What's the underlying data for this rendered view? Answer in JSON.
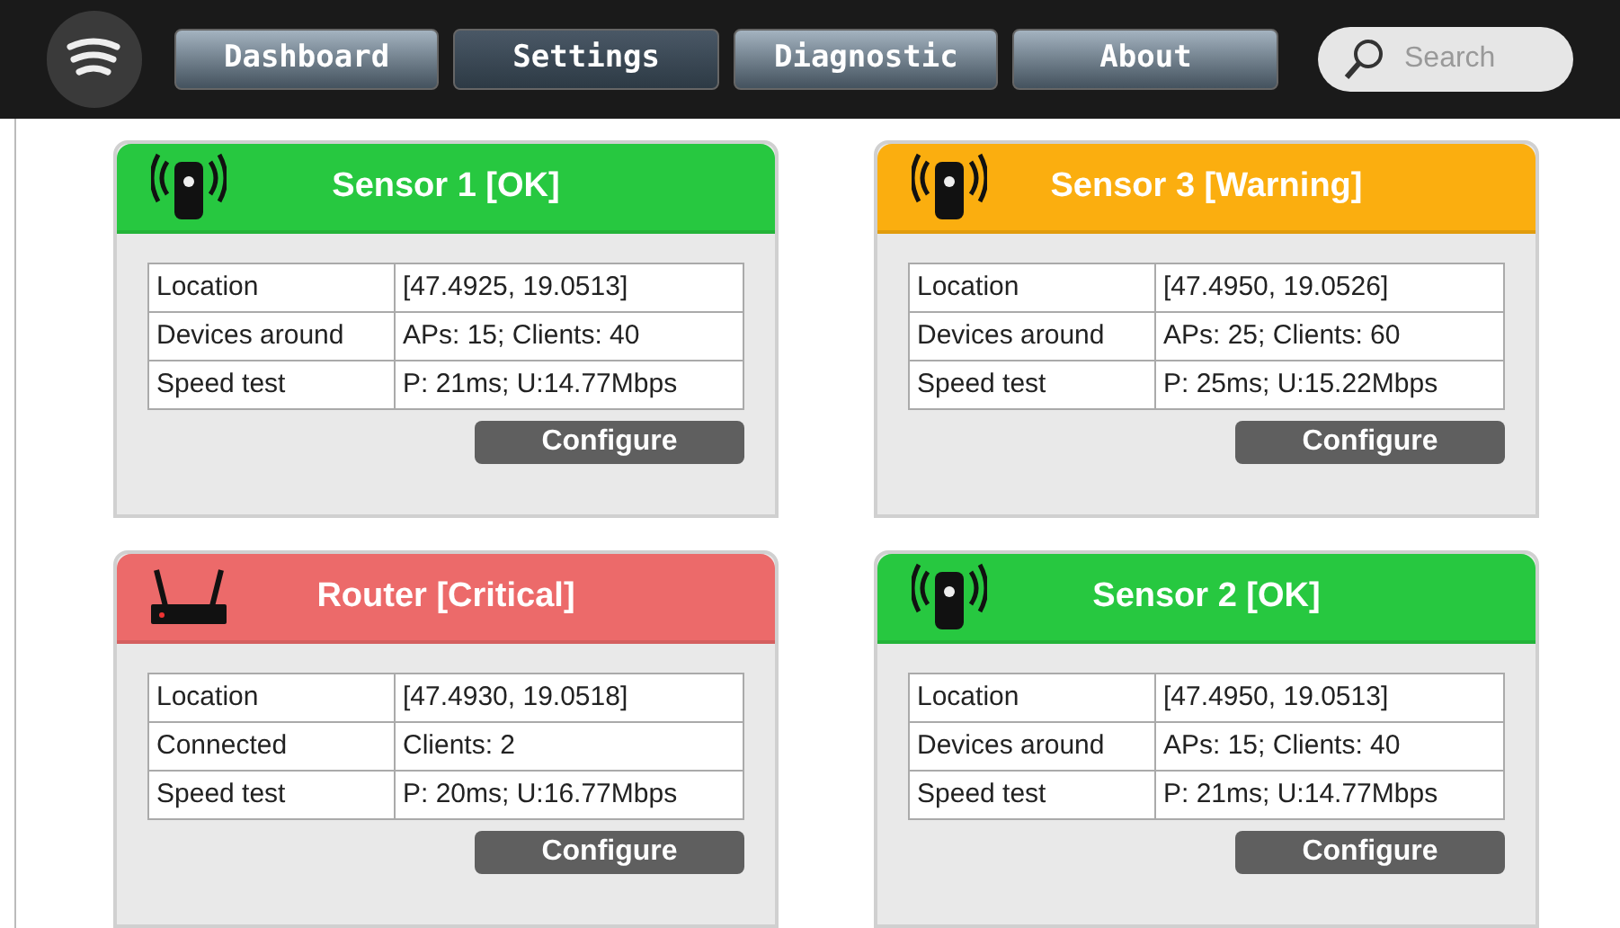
{
  "nav": {
    "tabs": [
      {
        "label": "Dashboard",
        "selected": false
      },
      {
        "label": "Settings",
        "selected": true
      },
      {
        "label": "Diagnostic",
        "selected": false
      },
      {
        "label": "About",
        "selected": false
      }
    ],
    "search": {
      "placeholder": "Search"
    }
  },
  "cards": [
    {
      "kind": "sensor",
      "color": "#27c840",
      "title": "Sensor 1 [OK]",
      "rows": [
        [
          "Location",
          "[47.4925, 19.0513]"
        ],
        [
          "Devices around",
          "APs: 15; Clients: 40"
        ],
        [
          "Speed test",
          "P: 21ms; U:14.77Mbps"
        ]
      ],
      "button": "Configure"
    },
    {
      "kind": "sensor",
      "color": "#fbae0f",
      "title": "Sensor 3 [Warning]",
      "rows": [
        [
          "Location",
          "[47.4950, 19.0526]"
        ],
        [
          "Devices around",
          "APs: 25; Clients: 60"
        ],
        [
          "Speed test",
          "P: 25ms; U:15.22Mbps"
        ]
      ],
      "button": "Configure"
    },
    {
      "kind": "router",
      "color": "#ec6a6a",
      "title": "Router [Critical]",
      "rows": [
        [
          "Location",
          "[47.4930, 19.0518]"
        ],
        [
          "Connected",
          "Clients: 2"
        ],
        [
          "Speed test",
          "P: 20ms; U:16.77Mbps"
        ]
      ],
      "button": "Configure"
    },
    {
      "kind": "sensor",
      "color": "#27c840",
      "title": "Sensor 2 [OK]",
      "rows": [
        [
          "Location",
          "[47.4950, 19.0513]"
        ],
        [
          "Devices around",
          "APs: 15; Clients: 40"
        ],
        [
          "Speed test",
          "P: 21ms; U:14.77Mbps"
        ]
      ],
      "button": "Configure"
    }
  ]
}
